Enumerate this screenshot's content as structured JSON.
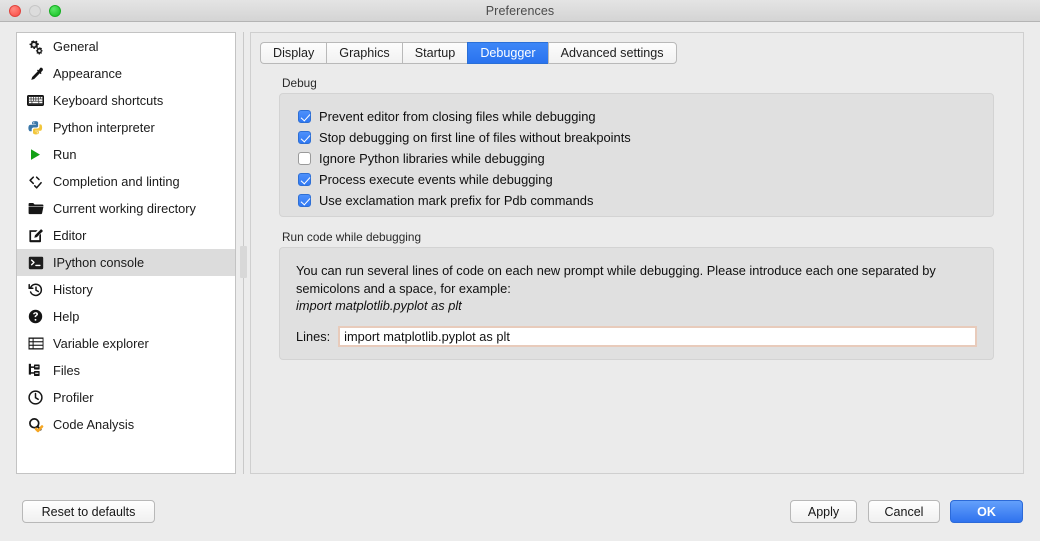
{
  "window": {
    "title": "Preferences",
    "controls": [
      {
        "name": "close",
        "color": "#fc5b54"
      },
      {
        "name": "minimize",
        "color": "#dcdcdc"
      },
      {
        "name": "zoom",
        "color": "#27ca35"
      }
    ]
  },
  "sidebar": {
    "items": [
      {
        "label": "General",
        "icon": "gears-icon",
        "selected": false
      },
      {
        "label": "Appearance",
        "icon": "eyedropper-icon",
        "selected": false
      },
      {
        "label": "Keyboard shortcuts",
        "icon": "keyboard-icon",
        "selected": false
      },
      {
        "label": "Python interpreter",
        "icon": "python-logo-icon",
        "selected": false
      },
      {
        "label": "Run",
        "icon": "play-triangle-icon",
        "selected": false
      },
      {
        "label": "Completion and linting",
        "icon": "code-brackets-icon",
        "selected": false
      },
      {
        "label": "Current working directory",
        "icon": "folder-icon",
        "selected": false
      },
      {
        "label": "Editor",
        "icon": "pencil-square-icon",
        "selected": false
      },
      {
        "label": "IPython console",
        "icon": "console-prompt-icon",
        "selected": true
      },
      {
        "label": "History",
        "icon": "history-clock-icon",
        "selected": false
      },
      {
        "label": "Help",
        "icon": "question-circle-icon",
        "selected": false
      },
      {
        "label": "Variable explorer",
        "icon": "table-grid-icon",
        "selected": false
      },
      {
        "label": "Files",
        "icon": "files-tree-icon",
        "selected": false
      },
      {
        "label": "Profiler",
        "icon": "clock-icon",
        "selected": false
      },
      {
        "label": "Code Analysis",
        "icon": "magnifier-check-icon",
        "selected": false
      }
    ]
  },
  "tabs": [
    {
      "label": "Display",
      "active": false
    },
    {
      "label": "Graphics",
      "active": false
    },
    {
      "label": "Startup",
      "active": false
    },
    {
      "label": "Debugger",
      "active": true
    },
    {
      "label": "Advanced settings",
      "active": false
    }
  ],
  "debug_group": {
    "title": "Debug",
    "checkboxes": [
      {
        "label": "Prevent editor from closing files while debugging",
        "checked": true
      },
      {
        "label": "Stop debugging on first line of files without breakpoints",
        "checked": true
      },
      {
        "label": "Ignore Python libraries while debugging",
        "checked": false
      },
      {
        "label": "Process execute events while debugging",
        "checked": true
      },
      {
        "label": "Use exclamation mark prefix for Pdb commands",
        "checked": true
      }
    ]
  },
  "run_code_group": {
    "title": "Run code while debugging",
    "description_line1": "You can run several lines of code on each new prompt while debugging. Please introduce each one separated by",
    "description_line2": "semicolons and a space, for example:",
    "description_example": "import matplotlib.pyplot as plt",
    "lines_label": "Lines:",
    "lines_value": "import matplotlib.pyplot as plt",
    "lines_placeholder": ""
  },
  "footer": {
    "reset_label": "Reset to defaults",
    "apply_label": "Apply",
    "cancel_label": "Cancel",
    "ok_label": "OK"
  },
  "colors": {
    "accent_blue": "#2f72ee",
    "tab_active": "#2a73ef",
    "selected_row": "#dcdcdc",
    "group_bg": "#e0e0e0",
    "panel_bg": "#ebebeb",
    "window_bg": "#ececec",
    "focus_border": "#e8cbbb"
  }
}
